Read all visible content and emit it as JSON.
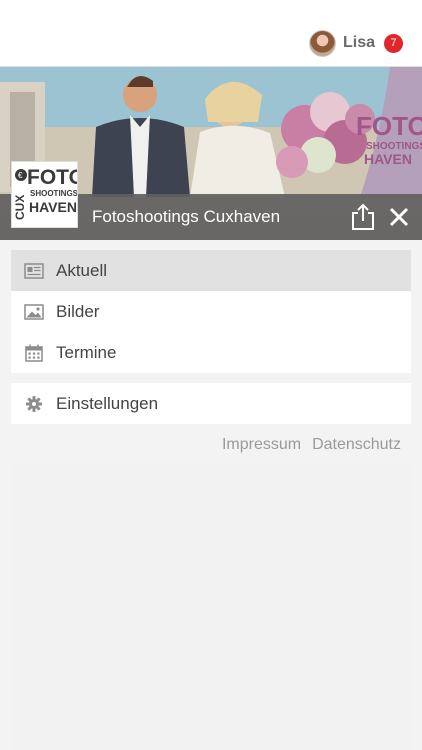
{
  "user": {
    "name": "Lisa",
    "notification_count": "7"
  },
  "header": {
    "title": "Fotoshootings Cuxhaven",
    "logo_text": [
      "FOTO",
      "SHOOTINGS",
      "HAVEN",
      "CUX"
    ],
    "share_icon": "share-icon",
    "close_icon": "close-icon"
  },
  "menu_primary": [
    {
      "label": "Aktuell",
      "icon": "newspaper-icon",
      "active": true
    },
    {
      "label": "Bilder",
      "icon": "image-icon",
      "active": false
    },
    {
      "label": "Termine",
      "icon": "calendar-icon",
      "active": false
    }
  ],
  "menu_secondary": [
    {
      "label": "Einstellungen",
      "icon": "gear-icon"
    }
  ],
  "footer": {
    "impressum": "Impressum",
    "datenschutz": "Datenschutz"
  },
  "colors": {
    "badge": "#e0262b",
    "title_bar": "#5f5f5f",
    "active_item": "#e1e1e1"
  }
}
